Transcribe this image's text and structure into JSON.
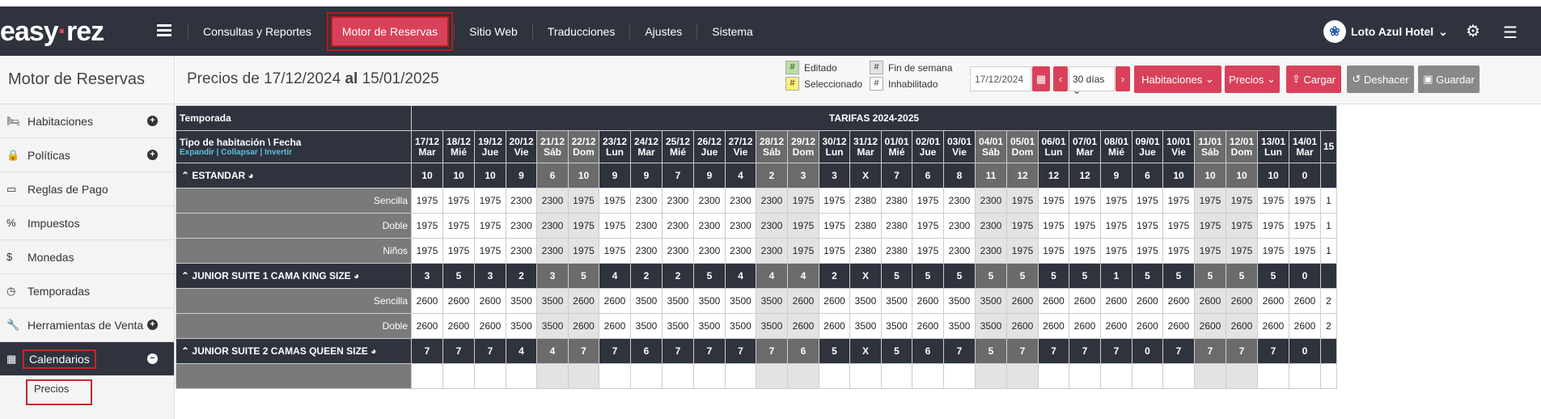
{
  "app": {
    "logo_left": "easy",
    "logo_dot": "·",
    "logo_right": "rez"
  },
  "nav": [
    {
      "label": "Consultas y Reportes"
    },
    {
      "label": "Motor de Reservas"
    },
    {
      "label": "Sitio Web"
    },
    {
      "label": "Traducciones"
    },
    {
      "label": "Ajustes"
    },
    {
      "label": "Sistema"
    }
  ],
  "user": {
    "name": "Loto Azul Hotel"
  },
  "sidebar": {
    "title": "Motor de Reservas",
    "items": [
      {
        "label": "Habitaciones",
        "icon": "bed-icon",
        "glyph": "🛏"
      },
      {
        "label": "Políticas",
        "icon": "lock-icon",
        "glyph": "🔒"
      },
      {
        "label": "Reglas de Pago",
        "icon": "credit-card-icon",
        "glyph": "▭"
      },
      {
        "label": "Impuestos",
        "icon": "percent-icon",
        "glyph": "%"
      },
      {
        "label": "Monedas",
        "icon": "dollar-icon",
        "glyph": "$"
      },
      {
        "label": "Temporadas",
        "icon": "clock-icon",
        "glyph": "◷"
      },
      {
        "label": "Herramientas de Venta",
        "icon": "wrench-icon",
        "glyph": "🔧"
      },
      {
        "label": "Calendarios",
        "icon": "calendar-icon",
        "glyph": "▦"
      }
    ],
    "sub": "Precios"
  },
  "toolbar": {
    "heading_prefix": "Precios de",
    "from": "17/12/2024",
    "mid": "al",
    "to": "15/01/2025",
    "legend": {
      "edited": "Editado",
      "selected": "Seleccionado",
      "weekend": "Fin de semana",
      "disabled": "Inhabilitado"
    },
    "date": "17/12/2024",
    "range": "30 días",
    "btn_rooms": "Habitaciones",
    "btn_prices": "Precios",
    "btn_load": "Cargar",
    "btn_undo": "Deshacer",
    "btn_save": "Guardar",
    "colors": {
      "edited": "#b9e0a5",
      "selected": "#fff176",
      "weekend": "#e3e3e3",
      "disabled": "#ffffff"
    }
  },
  "grid": {
    "season_label": "Temporada",
    "season_name": "TARIFAS 2024-2025",
    "header_label": "Tipo de habitación \\ Fecha",
    "links": [
      "Expandir",
      "Collapsar",
      "Invertir"
    ],
    "dates": [
      {
        "d": "17/12",
        "w": "Mar"
      },
      {
        "d": "18/12",
        "w": "Mié"
      },
      {
        "d": "19/12",
        "w": "Jue"
      },
      {
        "d": "20/12",
        "w": "Vie"
      },
      {
        "d": "21/12",
        "w": "Sáb"
      },
      {
        "d": "22/12",
        "w": "Dom"
      },
      {
        "d": "23/12",
        "w": "Lun"
      },
      {
        "d": "24/12",
        "w": "Mar"
      },
      {
        "d": "25/12",
        "w": "Mié"
      },
      {
        "d": "26/12",
        "w": "Jue"
      },
      {
        "d": "27/12",
        "w": "Vie"
      },
      {
        "d": "28/12",
        "w": "Sáb"
      },
      {
        "d": "29/12",
        "w": "Dom"
      },
      {
        "d": "30/12",
        "w": "Lun"
      },
      {
        "d": "31/12",
        "w": "Mar"
      },
      {
        "d": "01/01",
        "w": "Mié"
      },
      {
        "d": "02/01",
        "w": "Jue"
      },
      {
        "d": "03/01",
        "w": "Vie"
      },
      {
        "d": "04/01",
        "w": "Sáb"
      },
      {
        "d": "05/01",
        "w": "Dom"
      },
      {
        "d": "06/01",
        "w": "Lun"
      },
      {
        "d": "07/01",
        "w": "Mar"
      },
      {
        "d": "08/01",
        "w": "Mié"
      },
      {
        "d": "09/01",
        "w": "Jue"
      },
      {
        "d": "10/01",
        "w": "Vie"
      },
      {
        "d": "11/01",
        "w": "Sáb"
      },
      {
        "d": "12/01",
        "w": "Dom"
      },
      {
        "d": "13/01",
        "w": "Lun"
      },
      {
        "d": "14/01",
        "w": "Mar"
      },
      {
        "d": "15",
        "w": ""
      }
    ],
    "weekend_idx": [
      4,
      5,
      11,
      12,
      18,
      19,
      25,
      26
    ],
    "rooms": [
      {
        "name": "ESTANDAR",
        "avail": [
          "10",
          "10",
          "10",
          "9",
          "6",
          "10",
          "9",
          "9",
          "7",
          "9",
          "4",
          "2",
          "3",
          "3",
          "X",
          "7",
          "6",
          "8",
          "11",
          "12",
          "12",
          "12",
          "9",
          "6",
          "10",
          "10",
          "10",
          "10",
          "0",
          ""
        ],
        "rates": [
          {
            "label": "Sencilla",
            "values": [
              "1975",
              "1975",
              "1975",
              "2300",
              "2300",
              "1975",
              "1975",
              "2300",
              "2300",
              "2300",
              "2300",
              "2300",
              "1975",
              "1975",
              "2380",
              "2380",
              "1975",
              "2300",
              "2300",
              "1975",
              "1975",
              "1975",
              "1975",
              "1975",
              "1975",
              "1975",
              "1975",
              "1975",
              "1975",
              "1"
            ]
          },
          {
            "label": "Doble",
            "values": [
              "1975",
              "1975",
              "1975",
              "2300",
              "2300",
              "1975",
              "1975",
              "2300",
              "2300",
              "2300",
              "2300",
              "2300",
              "1975",
              "1975",
              "2380",
              "2380",
              "1975",
              "2300",
              "2300",
              "1975",
              "1975",
              "1975",
              "1975",
              "1975",
              "1975",
              "1975",
              "1975",
              "1975",
              "1975",
              "1"
            ]
          },
          {
            "label": "Niños",
            "values": [
              "1975",
              "1975",
              "1975",
              "2300",
              "2300",
              "1975",
              "1975",
              "2300",
              "2300",
              "2300",
              "2300",
              "2300",
              "1975",
              "1975",
              "2380",
              "2380",
              "1975",
              "2300",
              "2300",
              "1975",
              "1975",
              "1975",
              "1975",
              "1975",
              "1975",
              "1975",
              "1975",
              "1975",
              "1975",
              "1"
            ]
          }
        ]
      },
      {
        "name": "JUNIOR SUITE 1 CAMA KING SIZE",
        "avail": [
          "3",
          "5",
          "3",
          "2",
          "3",
          "5",
          "4",
          "2",
          "2",
          "5",
          "4",
          "4",
          "4",
          "2",
          "X",
          "5",
          "5",
          "5",
          "5",
          "5",
          "5",
          "5",
          "1",
          "5",
          "5",
          "5",
          "5",
          "5",
          "0",
          ""
        ],
        "rates": [
          {
            "label": "Sencilla",
            "values": [
              "2600",
              "2600",
              "2600",
              "3500",
              "3500",
              "2600",
              "2600",
              "3500",
              "3500",
              "3500",
              "3500",
              "3500",
              "2600",
              "2600",
              "3500",
              "3500",
              "2600",
              "3500",
              "3500",
              "2600",
              "2600",
              "2600",
              "2600",
              "2600",
              "2600",
              "2600",
              "2600",
              "2600",
              "2600",
              "2"
            ]
          },
          {
            "label": "Doble",
            "values": [
              "2600",
              "2600",
              "2600",
              "3500",
              "3500",
              "2600",
              "2600",
              "3500",
              "3500",
              "3500",
              "3500",
              "3500",
              "2600",
              "2600",
              "3500",
              "3500",
              "2600",
              "3500",
              "3500",
              "2600",
              "2600",
              "2600",
              "2600",
              "2600",
              "2600",
              "2600",
              "2600",
              "2600",
              "2600",
              "2"
            ]
          }
        ]
      },
      {
        "name": "JUNIOR SUITE 2 CAMAS QUEEN SIZE",
        "avail": [
          "7",
          "7",
          "7",
          "4",
          "4",
          "7",
          "7",
          "6",
          "7",
          "7",
          "7",
          "7",
          "6",
          "5",
          "X",
          "5",
          "6",
          "7",
          "5",
          "7",
          "7",
          "7",
          "7",
          "0",
          "7",
          "7",
          "7",
          "7",
          "0",
          ""
        ],
        "rates": []
      }
    ]
  }
}
